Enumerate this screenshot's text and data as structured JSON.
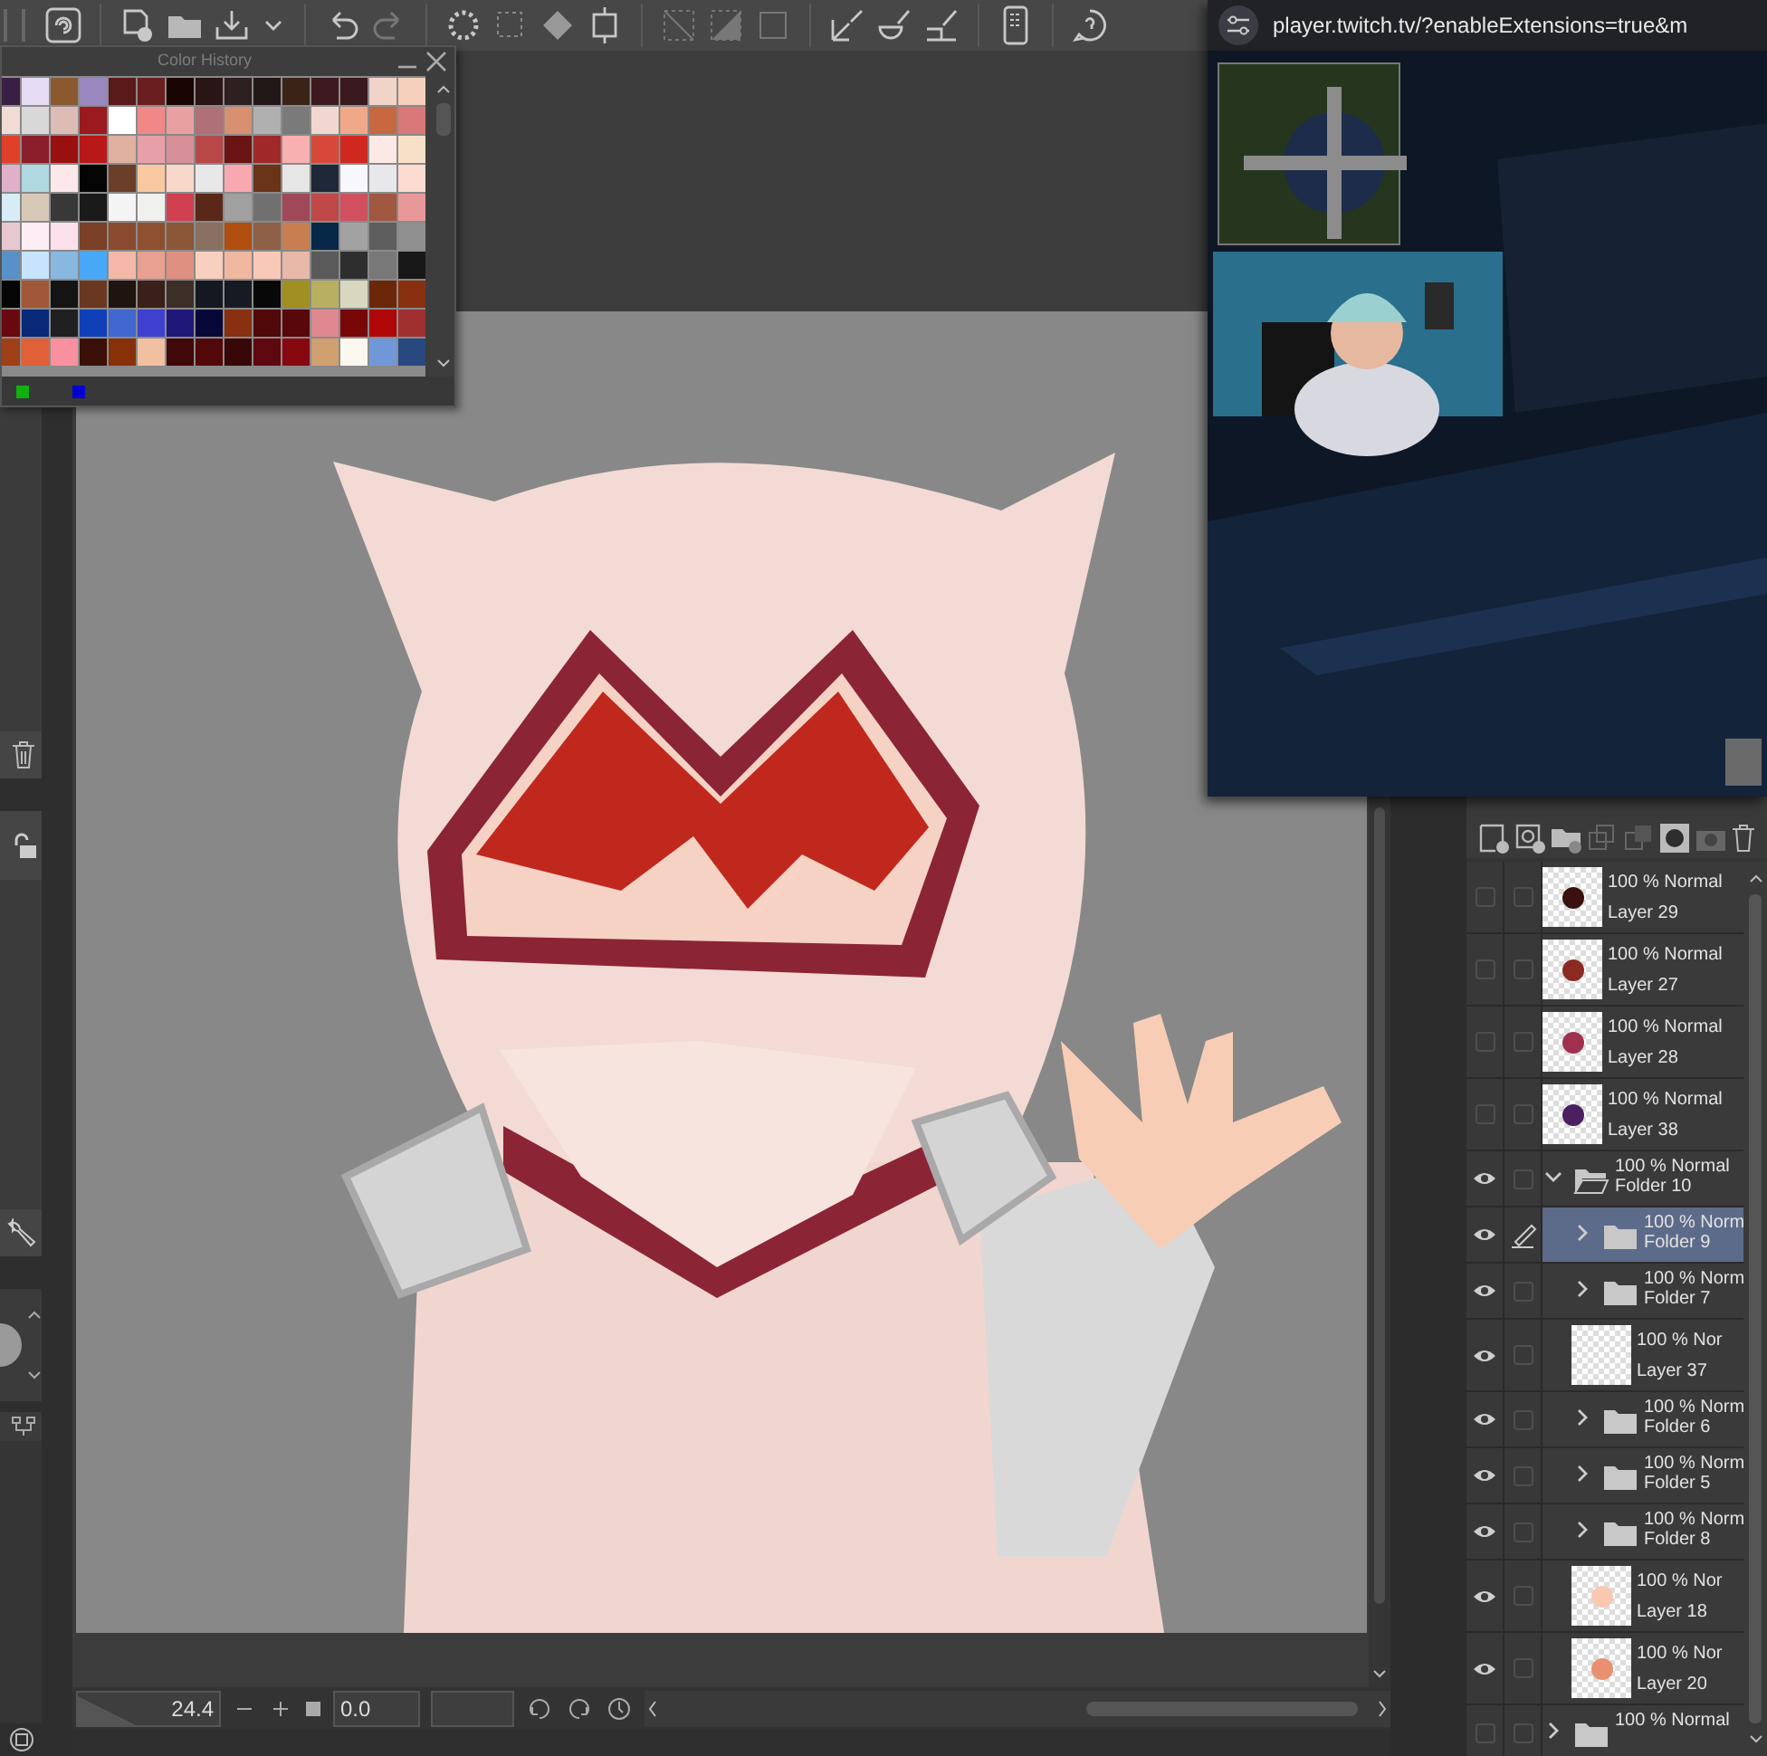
{
  "color_history": {
    "title": "Color History",
    "rows": [
      {
        "swatches": [
          {
            "color": "#3a1f45"
          },
          {
            "color": "#e6dcf5"
          },
          {
            "color": "#8a5a2e"
          },
          {
            "color": "#9a88c0"
          },
          {
            "color": "#5a1a1a"
          },
          {
            "color": "#6a1e20"
          },
          {
            "color": "#1a0505"
          },
          {
            "color": "#2a1515"
          },
          {
            "color": "#2e2020"
          },
          {
            "color": "#221818"
          },
          {
            "color": "#3a2418"
          },
          {
            "color": "#3e1a20"
          },
          {
            "color": "#3a1a1e"
          },
          {
            "color": "#f0d4c8"
          },
          {
            "color": "#f5d0bc"
          }
        ]
      },
      {
        "swatches": [
          {
            "color": "#f0dcd4"
          },
          {
            "color": "#d8d8d8"
          },
          {
            "color": "#dcbcb4"
          },
          {
            "color": "#9a1a20"
          },
          {
            "color": "#ffffff"
          },
          {
            "color": "#f08888"
          },
          {
            "color": "#e8a0a0"
          },
          {
            "color": "#b07078"
          },
          {
            "color": "#d89070"
          },
          {
            "color": "#b0b0b0"
          },
          {
            "color": "#7a7a7a"
          },
          {
            "color": "#f0d8d0"
          },
          {
            "color": "#f0a888"
          },
          {
            "color": "#c86840"
          },
          {
            "color": "#d87878"
          }
        ]
      },
      {
        "swatches": [
          {
            "color": "#e04028"
          },
          {
            "color": "#8a1e2a"
          },
          {
            "color": "#9a1010"
          },
          {
            "color": "#b81818"
          },
          {
            "color": "#e0b0a0"
          },
          {
            "color": "#e8a0a8"
          },
          {
            "color": "#d89098"
          },
          {
            "color": "#b84848"
          },
          {
            "color": "#6a1414"
          },
          {
            "color": "#a02828"
          },
          {
            "color": "#f8b0b0"
          },
          {
            "color": "#d84838"
          },
          {
            "color": "#d02820"
          },
          {
            "color": "#fce8e4"
          },
          {
            "color": "#f8e0c8"
          }
        ]
      },
      {
        "swatches": [
          {
            "color": "#e0b0c8"
          },
          {
            "color": "#b0d8e0"
          },
          {
            "color": "#fce8e8"
          },
          {
            "color": "#050505"
          },
          {
            "color": "#6a3e28"
          },
          {
            "color": "#f8c8a0"
          },
          {
            "color": "#f8d8c8"
          },
          {
            "color": "#e8e8e8"
          },
          {
            "color": "#f8a8b0"
          },
          {
            "color": "#6a3418"
          },
          {
            "color": "#e6e6e6"
          },
          {
            "color": "#1e2838"
          },
          {
            "color": "#f8f8fc"
          },
          {
            "color": "#e8e8ec"
          },
          {
            "color": "#fcdcd0"
          }
        ]
      },
      {
        "swatches": [
          {
            "color": "#d8ecf8"
          },
          {
            "color": "#d8c8b8"
          },
          {
            "color": "#383838"
          },
          {
            "color": "#1a1a1a"
          },
          {
            "color": "#f4f4f4"
          },
          {
            "color": "#f0f0ec"
          },
          {
            "color": "#d04050"
          },
          {
            "color": "#5a2818"
          },
          {
            "color": "#a0a0a0"
          },
          {
            "color": "#707070"
          },
          {
            "color": "#a04858"
          },
          {
            "color": "#c04848"
          },
          {
            "color": "#d05060"
          },
          {
            "color": "#a05840"
          },
          {
            "color": "#e89898"
          }
        ]
      },
      {
        "swatches": [
          {
            "color": "#e8c8d0"
          },
          {
            "color": "#fceef4"
          },
          {
            "color": "#fce0ec"
          },
          {
            "color": "#7a4028"
          },
          {
            "color": "#8a4a30"
          },
          {
            "color": "#8e5030"
          },
          {
            "color": "#8a5838"
          },
          {
            "color": "#8a7060"
          },
          {
            "color": "#b04e10"
          },
          {
            "color": "#8e6048"
          },
          {
            "color": "#c87e50"
          },
          {
            "color": "#082848"
          },
          {
            "color": "#a2a2a2"
          },
          {
            "color": "#5e5e5e"
          },
          {
            "color": "#909090"
          }
        ]
      },
      {
        "swatches": [
          {
            "color": "#5890c8"
          },
          {
            "color": "#c8e4fc"
          },
          {
            "color": "#88b8e0"
          },
          {
            "color": "#48a8f8"
          },
          {
            "color": "#f4b8a8"
          },
          {
            "color": "#e8a090"
          },
          {
            "color": "#e09080"
          },
          {
            "color": "#f8d0c0"
          },
          {
            "color": "#f0b8a0"
          },
          {
            "color": "#f8c8b8"
          },
          {
            "color": "#e8b8a8"
          },
          {
            "color": "#5a5a5a"
          },
          {
            "color": "#2e2e2e"
          },
          {
            "color": "#787878"
          },
          {
            "color": "#181818"
          }
        ]
      },
      {
        "swatches": [
          {
            "color": "#050505"
          },
          {
            "color": "#a05838"
          },
          {
            "color": "#141414"
          },
          {
            "color": "#6a3820"
          },
          {
            "color": "#201410"
          },
          {
            "color": "#3a2018"
          },
          {
            "color": "#3e2e28"
          },
          {
            "color": "#141820"
          },
          {
            "color": "#161a22"
          },
          {
            "color": "#080808"
          },
          {
            "color": "#a09020"
          },
          {
            "color": "#b8b060"
          },
          {
            "color": "#d8d8c0"
          },
          {
            "color": "#6a2808"
          },
          {
            "color": "#883010"
          }
        ]
      },
      {
        "swatches": [
          {
            "color": "#6a0810"
          },
          {
            "color": "#082878"
          },
          {
            "color": "#202020"
          },
          {
            "color": "#1040b8"
          },
          {
            "color": "#4068d0"
          },
          {
            "color": "#4040d0"
          },
          {
            "color": "#201878"
          },
          {
            "color": "#080838"
          },
          {
            "color": "#883010"
          },
          {
            "color": "#500808"
          },
          {
            "color": "#580808"
          },
          {
            "color": "#e08890"
          },
          {
            "color": "#780808"
          },
          {
            "color": "#b00808"
          },
          {
            "color": "#a03030"
          }
        ]
      },
      {
        "swatches": [
          {
            "color": "#a04018"
          },
          {
            "color": "#e06038"
          },
          {
            "color": "#f890a0"
          },
          {
            "color": "#3a1008"
          },
          {
            "color": "#883008"
          },
          {
            "color": "#f0c0a0"
          },
          {
            "color": "#400808"
          },
          {
            "color": "#520808"
          },
          {
            "color": "#380808"
          },
          {
            "color": "#600810"
          },
          {
            "color": "#880810"
          },
          {
            "color": "#d0a070"
          },
          {
            "color": "#fcf8f0"
          },
          {
            "color": "#7098d8"
          },
          {
            "color": "#284880"
          }
        ]
      }
    ],
    "indicators": [
      {
        "color": "#10b010"
      },
      {
        "color": "#0000d0"
      }
    ]
  },
  "browser_popup": {
    "url": "player.twitch.tv/?enableExtensions=true&m"
  },
  "navigator": {
    "zoom": "24.4",
    "rotation": "0.0"
  },
  "layers": [
    {
      "kind": "layer",
      "blend": "100 % Normal",
      "name": "Layer 29",
      "visible": false,
      "editing": false,
      "selected": false,
      "color": "#3a1010"
    },
    {
      "kind": "layer",
      "blend": "100 % Normal",
      "name": "Layer 27",
      "visible": false,
      "editing": false,
      "selected": false,
      "color": "#8a2a20"
    },
    {
      "kind": "layer",
      "blend": "100 % Normal",
      "name": "Layer 28",
      "visible": false,
      "editing": false,
      "selected": false,
      "color": "#a03050"
    },
    {
      "kind": "layer",
      "blend": "100 % Normal",
      "name": "Layer 38",
      "visible": false,
      "editing": false,
      "selected": false,
      "color": "#4a2060"
    },
    {
      "kind": "folder",
      "blend": "100 % Normal",
      "name": "Folder 10",
      "visible": true,
      "editing": false,
      "selected": false,
      "expanded": true,
      "children": [
        {
          "kind": "folder",
          "blend": "100 % Norm",
          "name": "Folder 9",
          "visible": true,
          "editing": true,
          "selected": true,
          "expanded": false
        },
        {
          "kind": "folder",
          "blend": "100 % Norm",
          "name": "Folder 7",
          "visible": true,
          "editing": false,
          "selected": false,
          "expanded": false
        },
        {
          "kind": "layer",
          "blend": "100 % Nor",
          "name": "Layer 37",
          "visible": true,
          "editing": false,
          "selected": false
        },
        {
          "kind": "folder",
          "blend": "100 % Norm",
          "name": "Folder 6",
          "visible": true,
          "editing": false,
          "selected": false,
          "expanded": false
        },
        {
          "kind": "folder",
          "blend": "100 % Norm",
          "name": "Folder 5",
          "visible": true,
          "editing": false,
          "selected": false,
          "expanded": false
        },
        {
          "kind": "folder",
          "blend": "100 % Norm",
          "name": "Folder 8",
          "visible": true,
          "editing": false,
          "selected": false,
          "expanded": false
        },
        {
          "kind": "layer",
          "blend": "100 % Nor",
          "name": "Layer 18",
          "visible": true,
          "editing": false,
          "selected": false,
          "color": "#f8c8b0"
        },
        {
          "kind": "layer",
          "blend": "100 % Nor",
          "name": "Layer 20",
          "visible": true,
          "editing": false,
          "selected": false,
          "color": "#e89070"
        }
      ]
    },
    {
      "kind": "folder",
      "blend": "100 % Normal",
      "visible": false,
      "editing": false,
      "selected": false,
      "expanded": false
    }
  ]
}
